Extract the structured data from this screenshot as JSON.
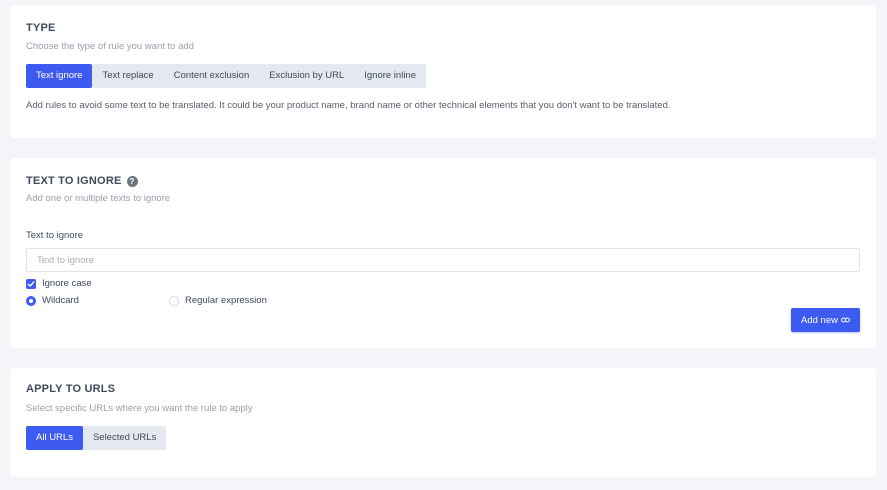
{
  "type_section": {
    "title": "TYPE",
    "subtitle": "Choose the type of rule you want to add",
    "tabs": [
      {
        "label": "Text ignore",
        "active": true
      },
      {
        "label": "Text replace",
        "active": false
      },
      {
        "label": "Content exclusion",
        "active": false
      },
      {
        "label": "Exclusion by URL",
        "active": false
      },
      {
        "label": "Ignore inline",
        "active": false
      }
    ],
    "description": "Add rules to avoid some text to be translated. It could be your product name, brand name or other technical elements that you don't want to be translated."
  },
  "text_section": {
    "title": "TEXT TO IGNORE",
    "help_icon": "question-circle-icon",
    "subtitle": "Add one or multiple texts to ignore",
    "field_label": "Text to ignore",
    "input_placeholder": "Text to ignore",
    "input_value": "",
    "ignore_case_label": "Ignore case",
    "ignore_case_checked": true,
    "match_options": [
      {
        "label": "Wildcard",
        "checked": true
      },
      {
        "label": "Regular expression",
        "checked": false
      }
    ],
    "add_button_label": "Add new",
    "add_button_icon": "link-icon"
  },
  "urls_section": {
    "title": "APPLY TO URLS",
    "subtitle": "Select specific URLs where you want the rule to apply",
    "tabs": [
      {
        "label": "All URLs",
        "active": true
      },
      {
        "label": "Selected URLs",
        "active": false
      }
    ]
  },
  "colors": {
    "accent": "#3d5af1",
    "background": "#f4f5f9",
    "card": "#ffffff",
    "segment_bg": "#e4e8ef"
  }
}
